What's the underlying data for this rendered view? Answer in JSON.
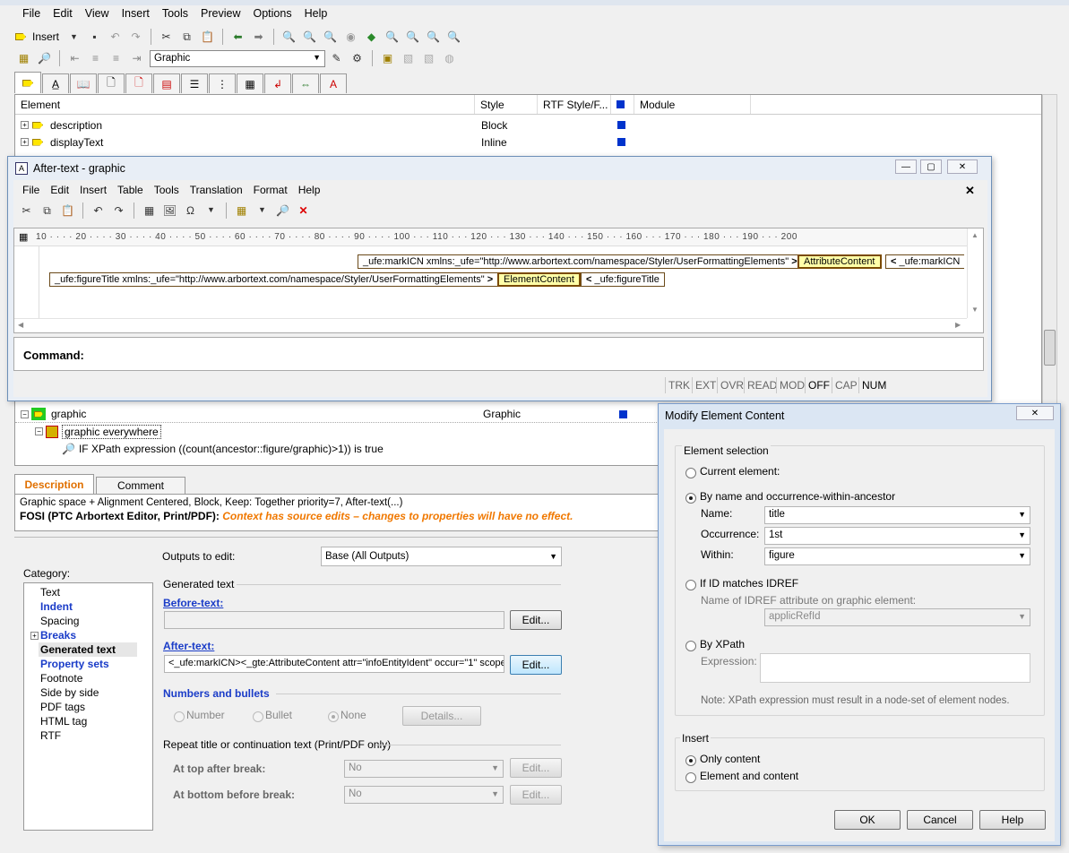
{
  "menu": [
    "File",
    "Edit",
    "View",
    "Insert",
    "Tools",
    "Preview",
    "Options",
    "Help"
  ],
  "toolbar": {
    "insert_label": "Insert",
    "style_combo": "Graphic"
  },
  "grid": {
    "headers": [
      "Element",
      "Style",
      "RTF Style/F...",
      "Module"
    ],
    "rows_top": [
      {
        "name": "description",
        "style": "Block"
      },
      {
        "name": "displayText",
        "style": "Inline"
      }
    ],
    "graphic_row": {
      "name": "graphic",
      "style": "Graphic"
    },
    "context_row": "graphic everywhere",
    "condition_row": "IF XPath expression ((count(ancestor::figure/graphic)>1)) is true"
  },
  "after_text_window": {
    "title": "After-text - graphic",
    "menu": [
      "File",
      "Edit",
      "Insert",
      "Table",
      "Tools",
      "Translation",
      "Format",
      "Help"
    ],
    "ruler": "10 · · · · 20 · · · · 30 · · · · 40 · · · · 50 · · · · 60 · · · · 70 · · · · 80 · · · · 90 · · · · 100 · · · 110 · · · 120 · · · 130 · · · 140 · · · 150 · · · 160 · · · 170 · · · 180 · · · 190 · · · 200",
    "line1_tag": "_ufe:markICN xmlns:_ufe=\"http://www.arbortext.com/namespace/Styler/UserFormattingElements\"",
    "line1_content": "AttributeContent",
    "line1_end": "_ufe:markICN",
    "line2_tag": "_ufe:figureTitle xmlns:_ufe=\"http://www.arbortext.com/namespace/Styler/UserFormattingElements\"",
    "line2_content": "ElementContent",
    "line2_end": "_ufe:figureTitle",
    "command_label": "Command:",
    "status": [
      "TRK",
      "EXT",
      "OVR",
      "READ",
      "MOD",
      "OFF",
      "CAP",
      "NUM"
    ]
  },
  "desc_tabs": [
    "Description",
    "Comment"
  ],
  "description": {
    "line1": "Graphic space + Alignment Centered, Block, Keep: Together priority=7, After-text(...)",
    "line2_bold": "FOSI (PTC Arbortext Editor, Print/PDF):",
    "line2_warn": "Context has source edits – changes to properties will have no effect."
  },
  "category": {
    "label": "Category:",
    "items": [
      "Text",
      "Indent",
      "Spacing",
      "Breaks",
      "Generated text",
      "Property sets",
      "Footnote",
      "Side by side",
      "PDF tags",
      "HTML tag",
      "RTF"
    ]
  },
  "props": {
    "outputs_label": "Outputs to edit:",
    "outputs_value": "Base (All Outputs)",
    "generated_text": "Generated text",
    "before_label": "Before-text:",
    "after_label": "After-text:",
    "after_value": "<_ufe:markICN><_gte:AttributeContent attr=\"infoEntityIdent\" occur=\"1\" scope",
    "edit": "Edit...",
    "numbers_label": "Numbers and bullets",
    "number": "Number",
    "bullet": "Bullet",
    "none": "None",
    "details": "Details...",
    "repeat_label": "Repeat title or continuation text (Print/PDF only)",
    "top_label": "At top after break:",
    "bottom_label": "At bottom before break:",
    "no": "No"
  },
  "dialog": {
    "title": "Modify Element Content",
    "selection_group": "Element selection",
    "current": "Current element:",
    "by_name": "By name and occurrence-within-ancestor",
    "name_label": "Name:",
    "name_value": "title",
    "occ_label": "Occurrence:",
    "occ_value": "1st",
    "within_label": "Within:",
    "within_value": "figure",
    "idref": "If ID matches IDREF",
    "idref_name_label": "Name of IDREF attribute on graphic element:",
    "idref_value": "applicRefId",
    "by_xpath": "By XPath",
    "expression": "Expression:",
    "note": "Note: XPath expression must result in a node-set of element nodes.",
    "insert_group": "Insert",
    "only_content": "Only content",
    "elem_content": "Element and content",
    "ok": "OK",
    "cancel": "Cancel",
    "help": "Help"
  }
}
